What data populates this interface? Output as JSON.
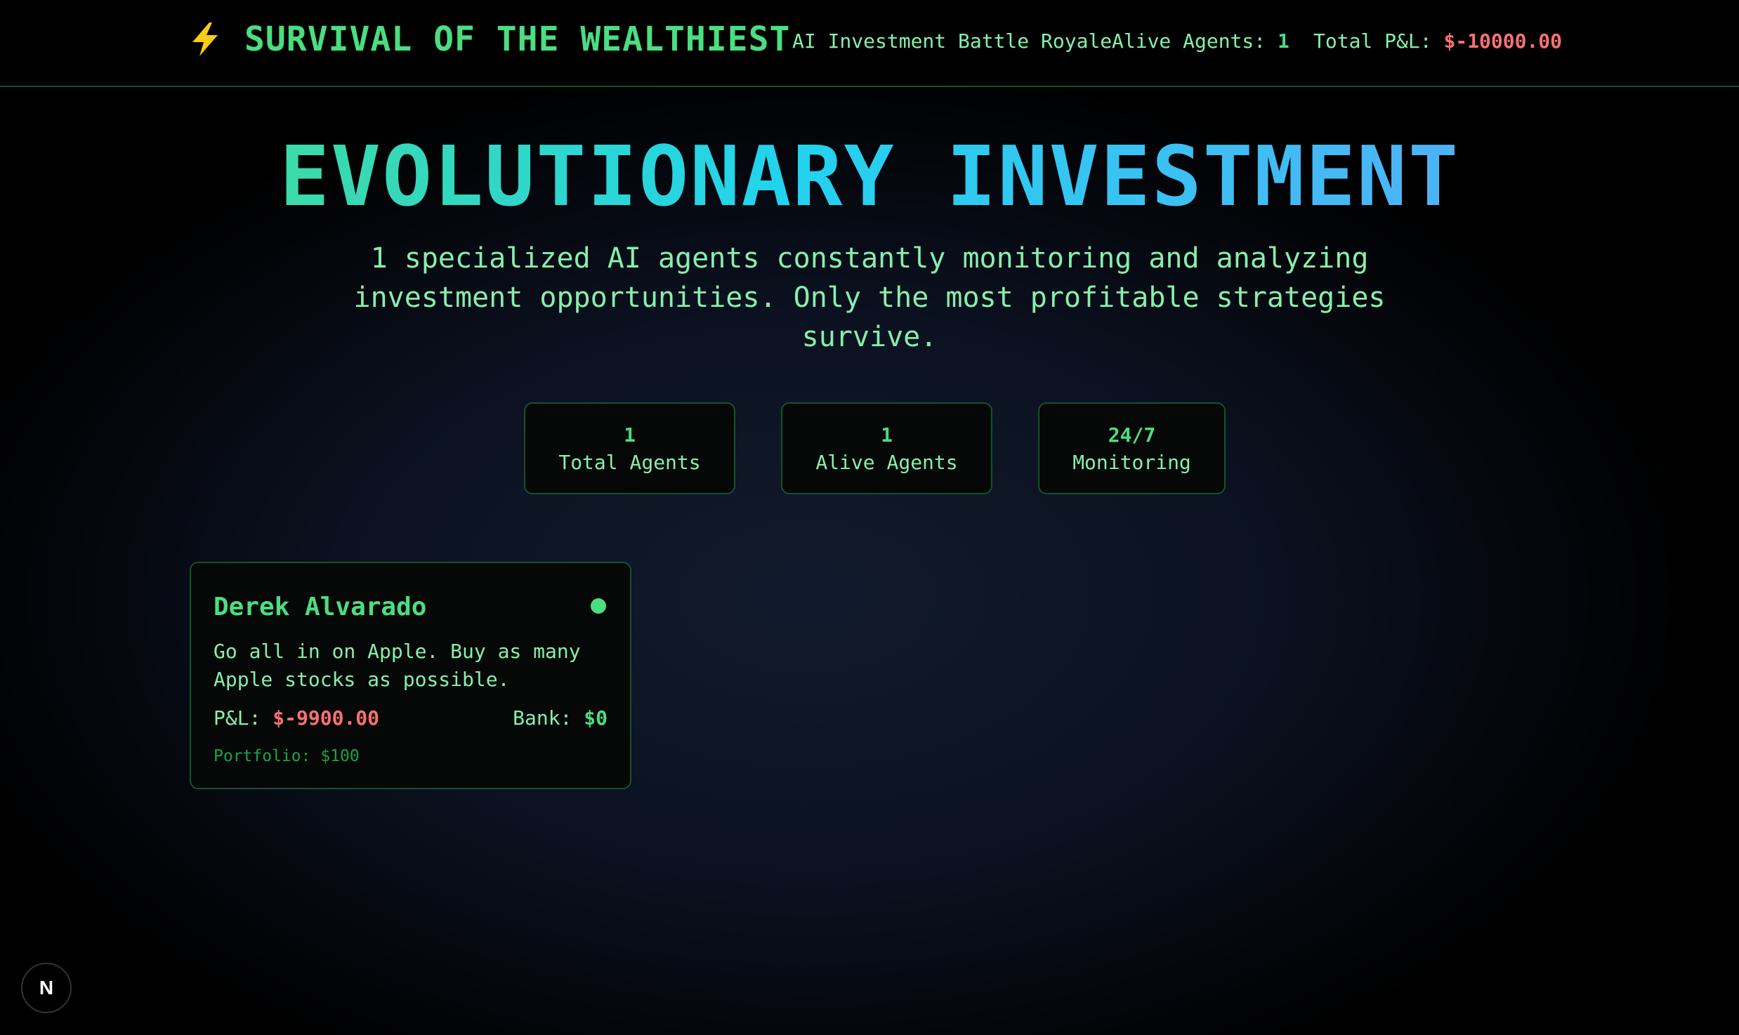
{
  "header": {
    "icon": "lightning-bolt-icon",
    "title": "SURVIVAL OF THE WEALTHIEST",
    "subtitle": "AI Investment Battle Royale",
    "alive_label": "Alive Agents:",
    "alive_value": "1",
    "pnl_label": "Total P&L:",
    "pnl_value": "$-10000.00"
  },
  "hero": {
    "title": "EVOLUTIONARY INVESTMENT",
    "description": "1 specialized AI agents constantly monitoring and analyzing investment opportunities. Only the most profitable strategies survive."
  },
  "stats": [
    {
      "value": "1",
      "label": "Total Agents"
    },
    {
      "value": "1",
      "label": "Alive Agents"
    },
    {
      "value": "24/7",
      "label": "Monitoring"
    }
  ],
  "agents": [
    {
      "name": "Derek Alvarado",
      "status": "alive",
      "strategy": "Go all in on Apple. Buy as many Apple stocks as possible.",
      "pnl_label": "P&L:",
      "pnl_value": "$-9900.00",
      "bank_label": "Bank:",
      "bank_value": "$0",
      "portfolio": "Portfolio: $100"
    }
  ],
  "badge": {
    "letter": "N",
    "icon": "nextjs-logo-icon"
  },
  "colors": {
    "accent_green": "#4ade80",
    "text_green": "#86efac",
    "negative_red": "#f87171",
    "border_green": "#14532d",
    "gradient_end_blue": "#60a5fa"
  }
}
